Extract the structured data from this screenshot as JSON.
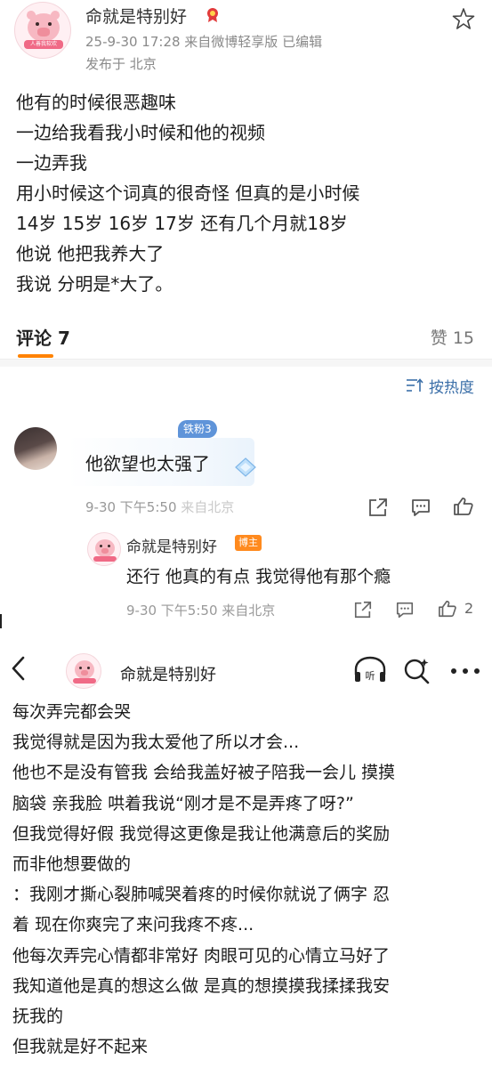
{
  "post": {
    "author": "命就是特别好",
    "avatar_text": "人善我软欢",
    "meta": "25-9-30 17:28  来自微博轻享版  已编辑",
    "location": "发布于 北京",
    "lines": [
      "他有的时候很恶趣味",
      "一边给我看我小时候和他的视频",
      "一边弄我",
      "用小时候这个词真的很奇怪 但真的是小时候",
      "14岁 15岁 16岁 17岁 还有几个月就18岁",
      "他说 他把我养大了",
      "我说 分明是*大了。"
    ]
  },
  "tabs": {
    "comments": "评论 7",
    "likes": "赞 15"
  },
  "sort": {
    "label": "按热度"
  },
  "comment": {
    "fan_badge": "铁粉3",
    "text": "他欲望也太强了",
    "time": "9-30 下午5:50 ",
    "source_fragment": "来自北京"
  },
  "reply": {
    "author": "命就是特别好",
    "author_tag": "博主",
    "text": "还行 他真的有点 我觉得他有那个瘾",
    "meta": "9-30 下午5:50  来自北京",
    "like_count": "2"
  },
  "second_screen": {
    "title": "命就是特别好",
    "lines": [
      "每次弄完都会哭",
      "我觉得就是因为我太爱他了所以才会...",
      "他也不是没有管我 会给我盖好被子陪我一会儿 摸摸",
      "脑袋 亲我脸 哄着我说“刚才是不是弄疼了呀?”",
      "但我觉得好假 我觉得这更像是我让他满意后的奖励",
      "而非他想要做的",
      "：我刚才撕心裂肺喊哭着疼的时候你就说了俩字 忍",
      "着 现在你爽完了来问我疼不疼...",
      "他每次弄完心情都非常好 肉眼可见的心情立马好了",
      "我知道他是真的想这么做 是真的想摸摸我揉揉我安",
      "抚我的",
      "但我就是好不起来"
    ]
  },
  "icons": {
    "star": "star-icon",
    "sort": "sort-icon",
    "share": "share-icon",
    "comment": "comment-icon",
    "like": "thumbs-up-icon",
    "back": "back-arrow-icon",
    "listen": "listen-icon",
    "search": "search-icon",
    "more": "more-icon"
  },
  "colors": {
    "accent": "#ff8200",
    "link": "#3b6fa8",
    "fan_badge": "#5f94d9",
    "author_tag": "#ff8a1e"
  }
}
